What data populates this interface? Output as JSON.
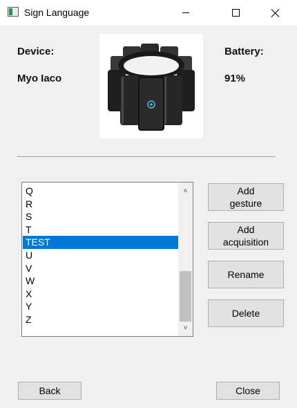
{
  "window": {
    "title": "Sign Language"
  },
  "header": {
    "device_label": "Device:",
    "device_name": "Myo Iaco",
    "battery_label": "Battery:",
    "battery_value": "91%"
  },
  "gestures": {
    "items": [
      "Q",
      "R",
      "S",
      "T",
      "TEST",
      "U",
      "V",
      "W",
      "X",
      "Y",
      "Z"
    ],
    "selected": "TEST"
  },
  "buttons": {
    "add_gesture": [
      "Add",
      "gesture"
    ],
    "add_acquisition": [
      "Add",
      "acquisition"
    ],
    "rename": "Rename",
    "delete": "Delete",
    "back": "Back",
    "close": "Close"
  },
  "colors": {
    "selection": "#0078d7",
    "background": "#f0f0f0"
  }
}
